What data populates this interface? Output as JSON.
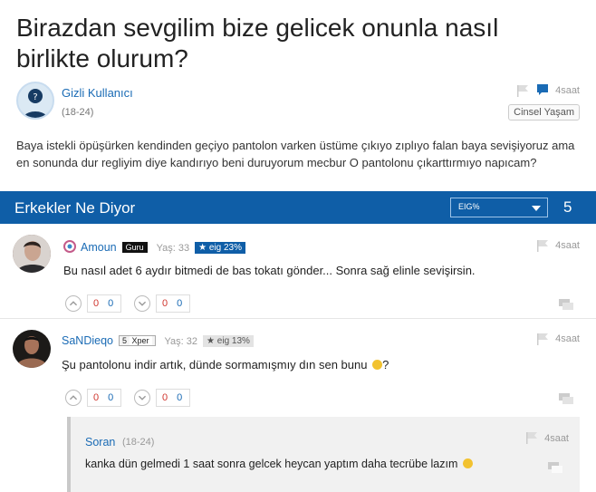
{
  "question": {
    "title": "Birazdan sevgilim bize gelicek onunla nasıl birlikte olurum?",
    "asker_name": "Gizli Kullanıcı",
    "asker_age": "(18-24)",
    "time": "4saat",
    "category": "Cinsel Yaşam",
    "body": "Baya istekli öpüşürken kendinden geçiyo pantolon varken üstüme çıkıyo zıplıyo falan baya sevişiyoruz ama en sonunda dur regliyim diye kandırıyo beni duruyorum mecbur O pantolonu çıkarttırmıyo napıcam?"
  },
  "section": {
    "title": "Erkekler Ne Diyor",
    "filter_value": "EIG%",
    "count": "5"
  },
  "answers": [
    {
      "name": "Amoun",
      "badge": "Guru",
      "age": "Yaş: 33",
      "mh_score": "eig 23%",
      "time": "4saat",
      "text": "Bu nasıl adet 6 aydır bitmedi de bas tokatı gönder... Sonra sağ elinle sevişirsin.",
      "vote1_a": "0",
      "vote1_b": "0",
      "vote2_a": "0",
      "vote2_b": "0"
    },
    {
      "name": "SaNDieqo",
      "badge_level": "5",
      "badge": "Xper",
      "age": "Yaş: 32",
      "mh_score": "eig 13%",
      "time": "4saat",
      "text": "Şu pantolonu indir artık, dünde sormamışmıy dın sen bunu",
      "text_end": "?",
      "vote1_a": "0",
      "vote1_b": "0",
      "vote2_a": "0",
      "vote2_b": "0"
    }
  ],
  "reply": {
    "name": "Soran",
    "age": "(18-24)",
    "time": "4saat",
    "text": "kanka dün gelmedi 1 saat sonra gelcek heycan yaptım daha tecrübe lazım"
  },
  "colors": {
    "header_blue": "#0f5ea7",
    "link_blue": "#1a6bb5",
    "vote_red": "#d0362f"
  }
}
